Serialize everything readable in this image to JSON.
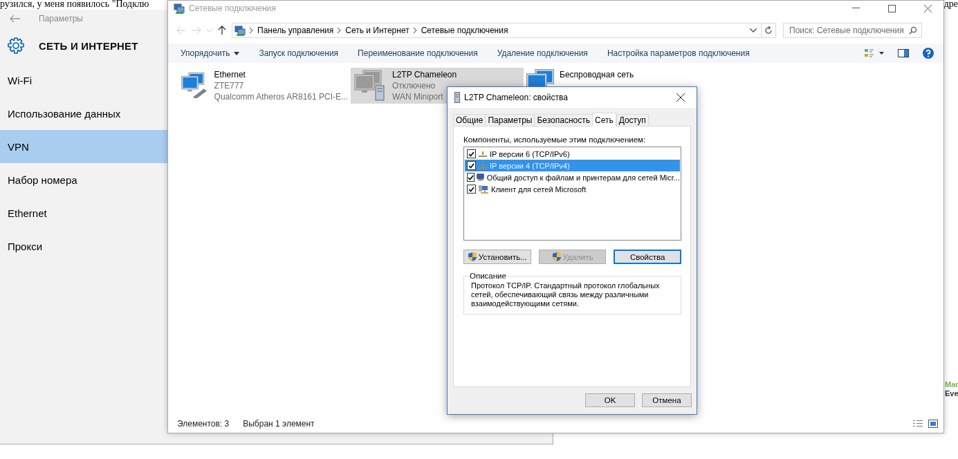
{
  "background_page": {
    "text_left": "рузился, у меня появилось \"Подклю",
    "text_right": "дре",
    "side_texts": [
      "Mar",
      "Eve"
    ]
  },
  "settings": {
    "title": "Параметры",
    "heading": "СЕТЬ И ИНТЕРНЕТ",
    "items": [
      {
        "label": "Wi-Fi",
        "selected": false
      },
      {
        "label": "Использование данных",
        "selected": false
      },
      {
        "label": "VPN",
        "selected": true
      },
      {
        "label": "Набор номера",
        "selected": false
      },
      {
        "label": "Ethernet",
        "selected": false
      },
      {
        "label": "Прокси",
        "selected": false
      }
    ]
  },
  "explorer": {
    "title": "Сетевые подключения",
    "breadcrumbs": [
      "Панель управления",
      "Сеть и Интернет",
      "Сетевые подключения"
    ],
    "search": {
      "placeholder": "Поиск: Сетевые подключения"
    },
    "commands": [
      {
        "label": "Упорядочить",
        "dropdown": true
      },
      {
        "label": "Запуск подключения",
        "dropdown": false
      },
      {
        "label": "Переименование подключения",
        "dropdown": false
      },
      {
        "label": "Удаление подключения",
        "dropdown": false
      },
      {
        "label": "Настройка параметров подключения",
        "dropdown": false
      }
    ],
    "connections": [
      {
        "kind": "ethernet",
        "name": "Ethernet",
        "lines": [
          "ZTE777",
          "Qualcomm Atheros AR8161 PCI-E..."
        ],
        "selected": false
      },
      {
        "kind": "vpn",
        "name": "L2TP Chameleon",
        "lines": [
          "Отключено",
          "WAN Miniport"
        ],
        "selected": true
      },
      {
        "kind": "wireless",
        "name": "Беспроводная сеть",
        "selected": false
      }
    ],
    "status_bar": [
      "Элементов: 3",
      "Выбран 1 элемент"
    ]
  },
  "dialog": {
    "title": "L2TP Chameleon: свойства",
    "tabs": [
      {
        "label": "Общие",
        "selected": false
      },
      {
        "label": "Параметры",
        "selected": false
      },
      {
        "label": "Безопасность",
        "selected": false
      },
      {
        "label": "Сеть",
        "selected": true
      },
      {
        "label": "Доступ",
        "selected": false
      }
    ],
    "components_label": "Компоненты, используемые этим подключением:",
    "components": [
      {
        "kind": "protocol",
        "label": "IP версии 6 (TCP/IPv6)",
        "checked": true,
        "selected": false
      },
      {
        "kind": "protocol",
        "label": "IP версии 4 (TCP/IPv4)",
        "checked": true,
        "selected": true
      },
      {
        "kind": "sharing",
        "label": "Общий доступ к файлам и принтерам для сетей Micr...",
        "checked": true,
        "selected": false
      },
      {
        "kind": "client",
        "label": "Клиент для сетей Microsoft",
        "checked": true,
        "selected": false
      }
    ],
    "buttons": [
      {
        "label": "Установить...",
        "shield": true,
        "disabled": false,
        "default": false
      },
      {
        "label": "Удалить",
        "shield": true,
        "disabled": true,
        "default": false
      },
      {
        "label": "Свойства",
        "shield": false,
        "disabled": false,
        "default": true
      }
    ],
    "description": {
      "title": "Описание",
      "text": "Протокол TCP/IP. Стандартный протокол глобальных сетей, обеспечивающий связь между различными взаимодействующими сетями."
    },
    "footer_buttons": [
      "OK",
      "Отмена"
    ]
  }
}
